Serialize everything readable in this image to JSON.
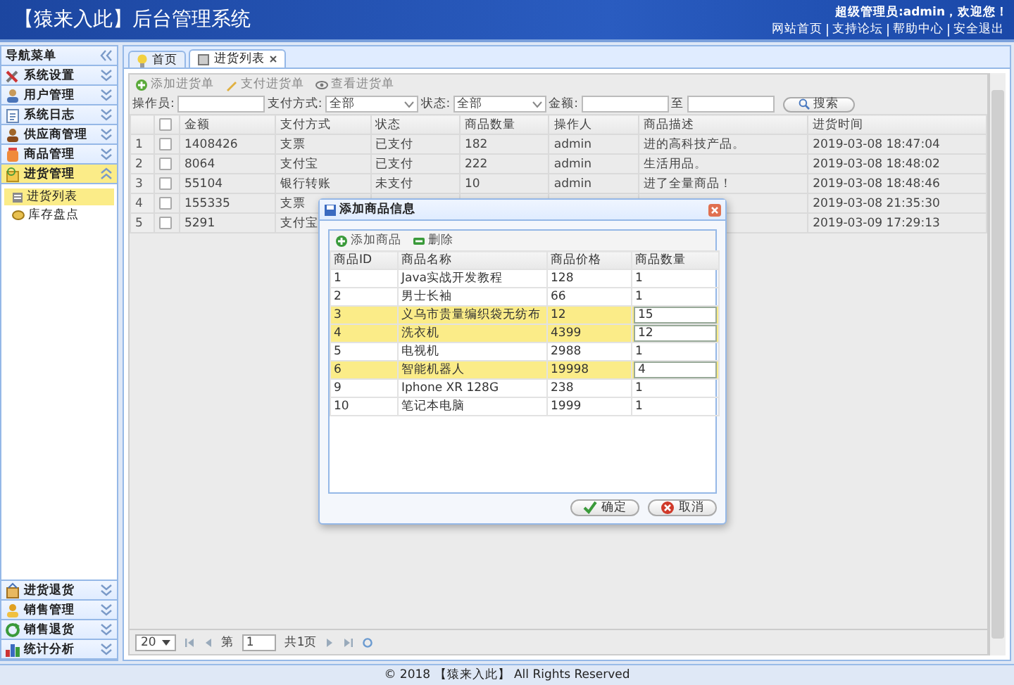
{
  "header": {
    "title": "【猿来入此】后台管理系统",
    "welcome": "超级管理员:admin，欢迎您！",
    "links": [
      "网站首页",
      "支持论坛",
      "帮助中心",
      "安全退出"
    ]
  },
  "sidebar": {
    "title": "导航菜单",
    "items": [
      {
        "label": "系统设置",
        "expanded": false
      },
      {
        "label": "用户管理",
        "expanded": false
      },
      {
        "label": "系统日志",
        "expanded": false
      },
      {
        "label": "供应商管理",
        "expanded": false
      },
      {
        "label": "商品管理",
        "expanded": false
      },
      {
        "label": "进货管理",
        "expanded": true,
        "children": [
          {
            "label": "进货列表",
            "selected": true
          },
          {
            "label": "库存盘点",
            "selected": false
          }
        ]
      },
      {
        "label": "进货退货",
        "expanded": false
      },
      {
        "label": "销售管理",
        "expanded": false
      },
      {
        "label": "销售退货",
        "expanded": false
      },
      {
        "label": "统计分析",
        "expanded": false
      }
    ]
  },
  "tabs": [
    {
      "label": "首页",
      "selected": false,
      "closable": false
    },
    {
      "label": "进货列表",
      "selected": true,
      "closable": true
    }
  ],
  "toolbar": [
    "添加进货单",
    "支付进货单",
    "查看进货单"
  ],
  "filters": [
    {
      "kind": "text",
      "label": "操作员:"
    },
    {
      "kind": "select",
      "label": "支付方式:",
      "value": "全部"
    },
    {
      "kind": "select",
      "label": "状态:",
      "value": "全部"
    },
    {
      "kind": "text",
      "label": "金额:"
    },
    {
      "kind": "text",
      "label": "至"
    }
  ],
  "search_button": "搜索",
  "table": {
    "select_all_checked": false,
    "columns": [
      "金额",
      "支付方式",
      "状态",
      "商品数量",
      "操作人",
      "商品描述",
      "进货时间"
    ],
    "rows": [
      {
        "number": "1",
        "checked": false,
        "amount": "1408426",
        "payment": "支票",
        "status": "已支付",
        "quantity": "182",
        "operator": "admin",
        "description": "进的高科技产品。",
        "time": "2019-03-08 18:47:04"
      },
      {
        "number": "2",
        "checked": false,
        "amount": "8064",
        "payment": "支付宝",
        "status": "已支付",
        "quantity": "222",
        "operator": "admin",
        "description": "生活用品。",
        "time": "2019-03-08 18:48:02"
      },
      {
        "number": "3",
        "checked": false,
        "amount": "55104",
        "payment": "银行转账",
        "status": "未支付",
        "quantity": "10",
        "operator": "admin",
        "description": "进了全量商品！",
        "time": "2019-03-08 18:48:46"
      },
      {
        "number": "4",
        "checked": false,
        "amount": "155335",
        "payment": "支票",
        "time": "2019-03-08 21:35:30"
      },
      {
        "number": "5",
        "checked": false,
        "amount": "5291",
        "payment": "支付宝",
        "time": "2019-03-09 17:29:13"
      }
    ]
  },
  "pager": {
    "page_size": "20",
    "page_prefix": "第",
    "page": "1",
    "total": "共1页"
  },
  "dialog": {
    "title": "添加商品信息",
    "toolbar": [
      "添加商品",
      "删除"
    ],
    "columns": [
      "商品ID",
      "商品名称",
      "商品价格",
      "商品数量"
    ],
    "rows": [
      {
        "id": "1",
        "name": "Java实战开发教程",
        "price": "128",
        "quantity": "1",
        "selected": false
      },
      {
        "id": "2",
        "name": "男士长袖",
        "price": "66",
        "quantity": "1",
        "selected": false
      },
      {
        "id": "3",
        "name": "义乌市贵量编织袋无纺布",
        "price": "12",
        "quantity": "15",
        "selected": true
      },
      {
        "id": "4",
        "name": "洗衣机",
        "price": "4399",
        "quantity": "12",
        "selected": true
      },
      {
        "id": "5",
        "name": "电视机",
        "price": "2988",
        "quantity": "1",
        "selected": false
      },
      {
        "id": "6",
        "name": "智能机器人",
        "price": "19998",
        "quantity": "4",
        "selected": true
      },
      {
        "id": "9",
        "name": "Iphone XR 128G",
        "price": "238",
        "quantity": "1",
        "selected": false
      },
      {
        "id": "10",
        "name": "笔记本电脑",
        "price": "1999",
        "quantity": "1",
        "selected": false
      }
    ],
    "buttons": [
      "确定",
      "取消"
    ]
  },
  "footer": "© 2018 【猿来入此】 All Rights Reserved"
}
